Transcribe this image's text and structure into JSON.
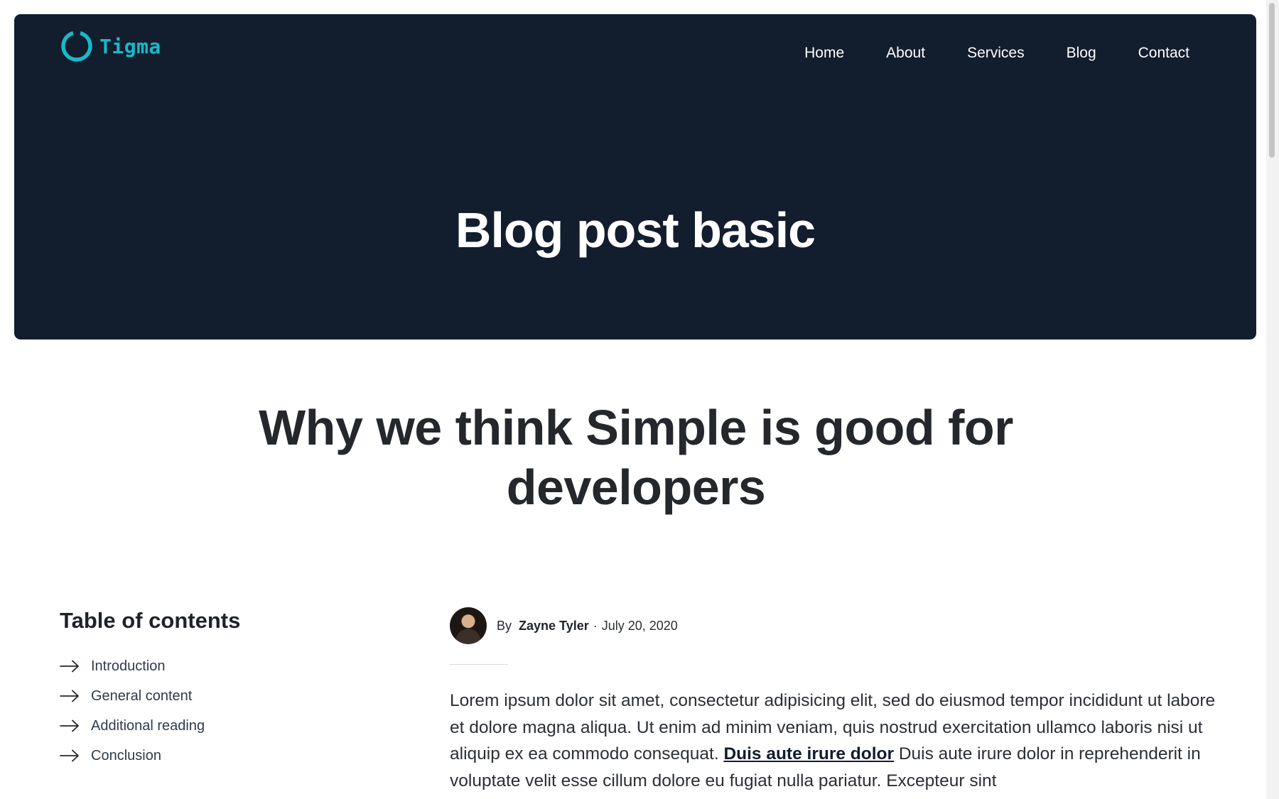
{
  "header": {
    "logo_text": "Tigma",
    "nav": [
      "Home",
      "About",
      "Services",
      "Blog",
      "Contact"
    ],
    "hero_title": "Blog post basic"
  },
  "article": {
    "title": "Why we think Simple is good for developers",
    "author": {
      "by": "By",
      "name": "Zayne Tyler",
      "separator": "·",
      "date": "July 20, 2020"
    },
    "paragraph": {
      "before_link": "Lorem ipsum dolor sit amet, consectetur adipisicing elit, sed do eiusmod tempor incididunt ut labore et dolore magna aliqua. Ut enim ad minim veniam, quis nostrud exercitation ullamco laboris nisi ut aliquip ex ea commodo consequat. ",
      "link": "Duis aute irure dolor",
      "after_link": " Duis aute irure dolor in reprehenderit in voluptate velit esse cillum dolore eu fugiat nulla pariatur. Excepteur sint"
    }
  },
  "toc": {
    "heading": "Table of contents",
    "items": [
      "Introduction",
      "General content",
      "Additional reading",
      "Conclusion"
    ]
  },
  "colors": {
    "hero_bg": "#121d2e",
    "logo_accent": "#19b9c9",
    "text_dark": "#24272c"
  }
}
